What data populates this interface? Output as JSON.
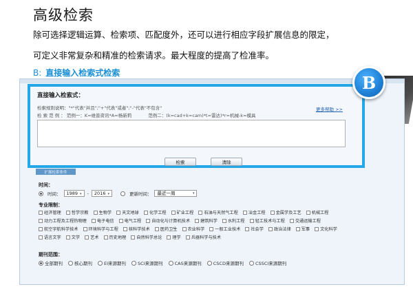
{
  "slide": {
    "title": "高级检索",
    "line1": "除可选择逻辑运算、检索项、匹配度外，还可以进行相应字段扩展信息的限定，",
    "line2": "可定义非常复杂和精准的检索请求。最大程度的提高了检准率。",
    "subhead_prefix": "B:",
    "subhead": "直接输入检索式检索",
    "badge": "B"
  },
  "direct": {
    "title": "直接输入检索式：",
    "syntax": "检索规则说明：\"*\"代表\"并且\";\"+\"代表\"或者\";\"-\"代表\"不包含\"",
    "example_label": "检 索 范 例 ：",
    "example1": "范例一：K=维普资讯*A=杨新莉",
    "example2": "范例二：(k=cad+k=cam)*t=雷达)*r=机械-k=模具",
    "help_link": "更多帮助 >>",
    "search_button": "检索",
    "clear_button": "清除"
  },
  "tab_stub": "扩展检索条件",
  "time": {
    "label": "时间：",
    "option_time": "时间：",
    "from_year": "1989",
    "to_year": "2016",
    "option_update": "更新时间：",
    "update_value": "最近一周"
  },
  "subjects": {
    "label": "专业限制：",
    "rows": [
      [
        "经济管理",
        "哲学宗教",
        "生物学",
        "天文地球",
        "化学工程",
        "矿业工程",
        "石油与天然气工程",
        "冶金工程",
        "金属学及工艺",
        "机械工程"
      ],
      [
        "动力工程及工程热物理",
        "电子电信",
        "电气工程",
        "自动化与计算机技术",
        "建筑科学",
        "水利工程",
        "轻工技术与工程",
        "交通运输工程"
      ],
      [
        "航空宇航科学技术",
        "环境科学与工程",
        "核科学技术",
        "医药卫生",
        "农业科学",
        "一般工业技术",
        "社会学",
        "政治法律",
        "军事",
        "文化科学"
      ],
      [
        "语言文字",
        "文学",
        "艺术",
        "历史地理",
        "自然科学总论",
        "理学",
        "兵器科学与技术"
      ]
    ]
  },
  "range": {
    "label": "期刊范围：",
    "options": [
      "全部期刊",
      "核心期刊",
      "EI来源期刊",
      "SCI来源期刊",
      "CAS来源期刊",
      "CSCD来源期刊",
      "CSSCI来源期刊"
    ]
  }
}
